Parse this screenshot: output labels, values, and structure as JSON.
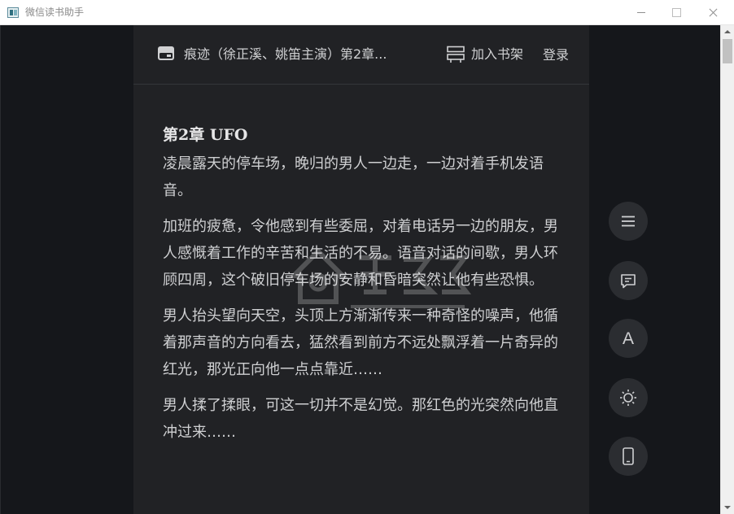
{
  "window": {
    "title": "微信读书助手",
    "icon": "app-icon",
    "controls": [
      "minimize-icon",
      "maximize-icon",
      "close-icon"
    ]
  },
  "header": {
    "book_icon": "book-icon",
    "book_title": "痕迹（徐正溪、姚笛主演）第2章...",
    "add_shelf_icon": "bookshelf-add-icon",
    "add_shelf_label": "加入书架",
    "login_label": "登录"
  },
  "chapter": {
    "title": "第2章 UFO",
    "paragraphs": [
      "凌晨露天的停车场，晚归的男人一边走，一边对着手机发语音。",
      "加班的疲惫，令他感到有些委屈，对着电话另一边的朋友，男人感慨着工作的辛苦和生活的不易。语音对话的间歇，男人环顾四周，这个破旧停车场的安静和昏暗突然让他有些恐惧。",
      "男人抬头望向天空，头顶上方渐渐传来一种奇怪的噪声，他循着那声音的方向看去，猛然看到前方不远处飘浮着一片奇异的红光，那光正向他一点点靠近……",
      "男人揉了揉眼，可这一切并不是幻觉。那红色的光突然向他直冲过来……"
    ]
  },
  "side_controls": {
    "menu_icon": "menu-icon",
    "notes_icon": "comment-icon",
    "font_label": "A",
    "theme_icon": "brightness-icon",
    "device_icon": "phone-icon"
  },
  "colors": {
    "background": "#15171b",
    "reader_panel": "#212225",
    "text": "#cfd0d2",
    "button": "#2b2d31"
  }
}
